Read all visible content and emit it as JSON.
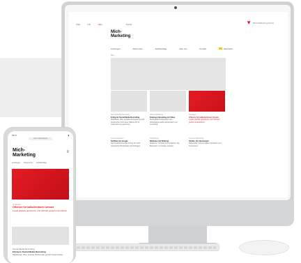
{
  "brand": {
    "logo_line1": "Mich-",
    "logo_line2": "Marketing",
    "accent": "#e31b23"
  },
  "desktop": {
    "top_links": [
      "Start",
      "Info",
      "Jobs"
    ],
    "top_search": "Suche",
    "top_right": "Mich-Marketing GmbH",
    "nav": [
      "Leistungen",
      "Referenzen",
      "Fachbeiträge",
      "Über uns",
      "Kontakt",
      "Newsletter"
    ],
    "hero_label": "Blog",
    "cards": [
      {
        "cat": "Social Media Recruiting",
        "title": "Erfolg im Social Media Recruiting",
        "body": "Mitarbeiter über soziale Netzwerke gezielt ansprechen und neue Talente für Ihr Unternehmen gewinnen."
      },
      {
        "cat": "Video-Marketing",
        "title": "Employer Branding mit Video",
        "body": "Bewegtbild transportiert Ihre Arbeitgebermarke authentisch und emotional."
      },
      {
        "cat": "Strategie",
        "title": "Offensiv für kalkulierbaren Umsatz",
        "body": "Leads planbar generieren und Vertrieb gezielt unterstützen."
      },
      {
        "cat": "Suchmaschinen",
        "title": "Sichtbar bei Google",
        "body": "Suchmaschinenoptimierung für mehr organische Reichweite und Anfragen."
      },
      {
        "cat": "Webdesign",
        "title": "Websites mit Wirkung",
        "body": "Moderne, schnelle Internetseiten, die Besucher zu Kunden machen."
      },
      {
        "cat": "Content Marketing",
        "title": "Inhalte, die überzeugen",
        "body": "Relevanter Content stärkt Vertrauen und Kompetenz."
      }
    ]
  },
  "mobile": {
    "status_time": "09:41",
    "url": "mich-marketing.de",
    "nav": [
      "Leistungen",
      "Referenzen",
      "Fachbeiträge"
    ],
    "hero_cat": "Strategie",
    "hero_title": "Offensiv für kalkulierbaren Umsatz",
    "hero_body": "Leads planbar generieren und Vertrieb gezielt unterstützen.",
    "card2_cat": "Social Media Recruiting",
    "card2_title": "Erfolg im Social Media Recruiting",
    "card2_body": "Mitarbeiter über soziale Netzwerke gezielt ansprechen."
  }
}
